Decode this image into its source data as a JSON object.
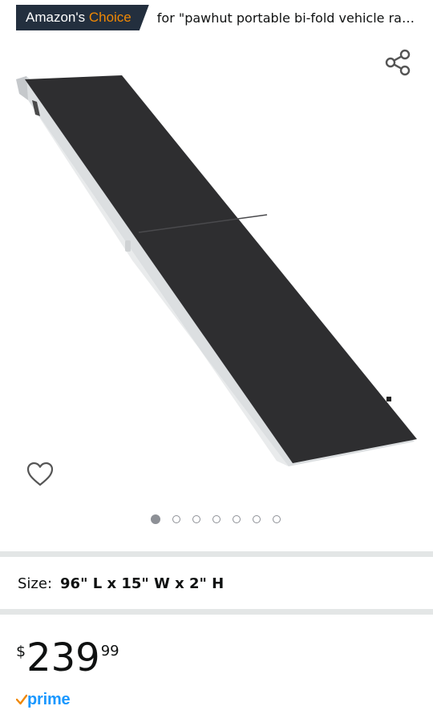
{
  "badge": {
    "prefix": "Amazon's",
    "accent": "Choice",
    "query": "for \"pawhut portable bi-fold vehicle ra…"
  },
  "icons": {
    "share": "share-icon",
    "heart": "heart-icon",
    "prime_check": "prime-check-icon"
  },
  "product": {
    "image_alt": "bi-fold vehicle ramp"
  },
  "carousel": {
    "total": 7,
    "active_index": 0
  },
  "size": {
    "label": "Size:",
    "value": "96\" L x 15\" W x 2\" H"
  },
  "price": {
    "symbol": "$",
    "whole": "239",
    "fraction": "99"
  },
  "prime": {
    "label": "prime"
  },
  "colors": {
    "badge_bg": "#232f3e",
    "badge_accent": "#f08804",
    "prime_blue": "#1a98ff",
    "divider": "#e3e6e6",
    "ramp_surface": "#2f2f31",
    "ramp_frame": "#d9dcde"
  }
}
